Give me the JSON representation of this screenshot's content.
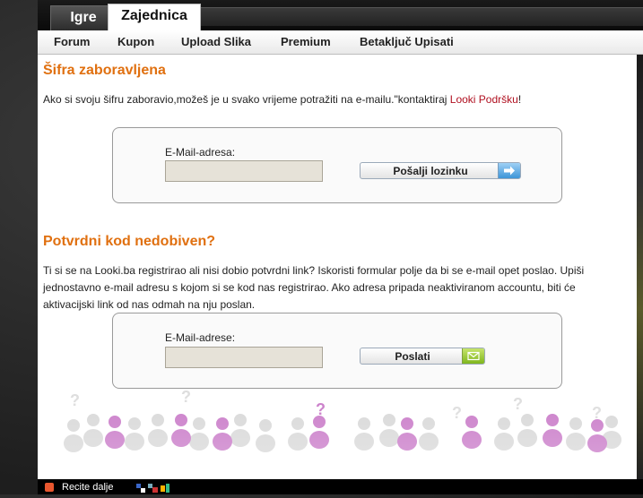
{
  "top_tabs": [
    {
      "label": "Igre"
    },
    {
      "label": "Zajednica"
    }
  ],
  "sub_nav": [
    {
      "label": "Forum"
    },
    {
      "label": "Kupon"
    },
    {
      "label": "Upload Slika"
    },
    {
      "label": "Premium"
    },
    {
      "label": "Betaključ Upisati"
    }
  ],
  "forgot": {
    "title": "Šifra zaboravljena",
    "text_before": "Ako si svoju šifru zaboravio,možeš je u svako vrijeme potražiti na e-mailu.\"kontaktiraj ",
    "link": "Looki Podršku",
    "text_after": "!",
    "field_label": "E-Mail-adresa:",
    "button": "Pošalji lozinku"
  },
  "confirm": {
    "title": "Potvrdni kod nedobiven?",
    "text": "Ti si se na Looki.ba registrirao ali nisi dobio potvrdni link? Iskoristi formular polje da bi se e-mail opet poslao. Upiši jednostavno e-mail adresu s kojom si se kod nas registrirao. Ako adresa pripada neaktiviranom accountu, biti će aktivacijski link od nas odmah na nju poslan.",
    "field_label": "E-Mail-adrese:",
    "button": "Poslati"
  },
  "footer": {
    "recite": "Recite dalje"
  },
  "colors": {
    "heading": "#e07010",
    "link": "#b01020"
  }
}
